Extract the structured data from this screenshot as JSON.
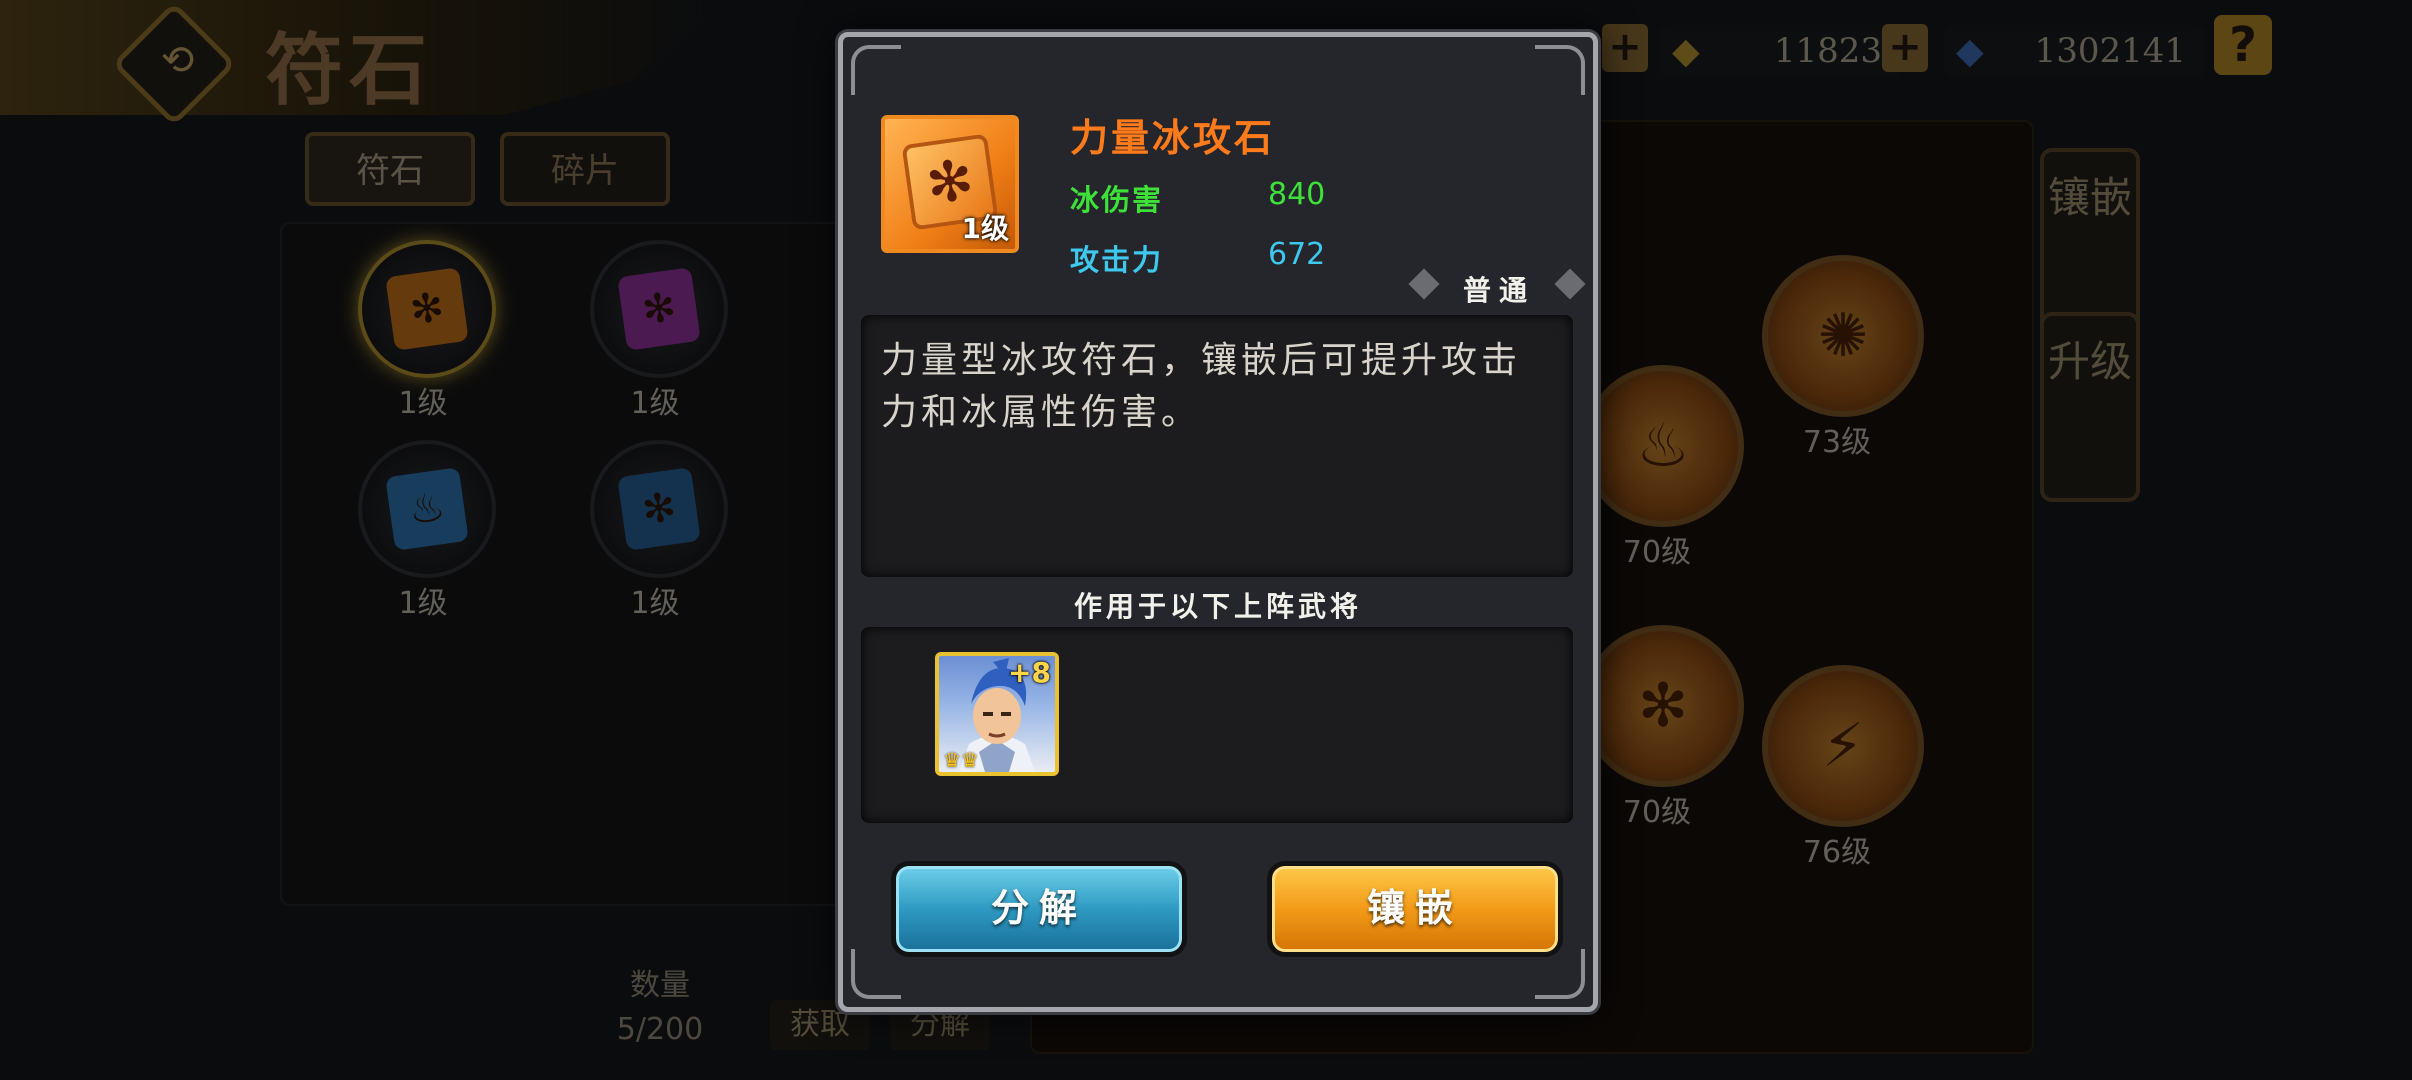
{
  "screen": {
    "title": "符石",
    "currency": [
      {
        "name": "gold-ingot",
        "value": "11823",
        "icon": "gold-ingot-icon"
      },
      {
        "name": "gem",
        "value": "1302141",
        "icon": "blue-gem-icon"
      }
    ],
    "help_label": "?",
    "plus_label": "+",
    "back_label": "⟲"
  },
  "tabs": [
    {
      "label": "符石"
    },
    {
      "label": "碎片"
    }
  ],
  "stone_list": [
    {
      "level": "1级",
      "color": "#f08a20",
      "icon": "snowflake-icon",
      "selected": true
    },
    {
      "level": "1级",
      "color": "#b03fbe",
      "icon": "snowflake-icon",
      "selected": false
    },
    {
      "level": "1级",
      "color": "#3a8fd8",
      "icon": "flame-icon",
      "selected": false
    },
    {
      "level": "1级",
      "color": "#2f77b8",
      "icon": "snowflake-icon",
      "selected": false
    }
  ],
  "inventory": {
    "count_label": "数量",
    "count_value": "5/200",
    "obtain_label": "获取",
    "decompose_label": "分解"
  },
  "ring": [
    {
      "level": "73级",
      "icon": "tornado-icon"
    },
    {
      "level": "70级",
      "icon": "flame-icon"
    },
    {
      "level": "70级",
      "icon": "snowflake-icon"
    },
    {
      "level": "76级",
      "icon": "claw-icon"
    }
  ],
  "side_tabs": [
    {
      "label": "镶嵌"
    },
    {
      "label": "升级"
    }
  ],
  "modal": {
    "item_name": "力量冰攻石",
    "item_level": "1级",
    "item_icon": "snowflake-icon",
    "stats": [
      {
        "label": "冰伤害",
        "value": "840",
        "color": "#3ee03a"
      },
      {
        "label": "攻击力",
        "value": "672",
        "color": "#3ec8ee"
      }
    ],
    "rarity": "普通",
    "description": "力量型冰攻符石，镶嵌后可提升攻击力和冰属性伤害。",
    "heroes_title": "作用于以下上阵武将",
    "heroes": [
      {
        "plus": "+8",
        "crowns": "♛♛"
      }
    ],
    "buttons": {
      "decompose": "分解",
      "inlay": "镶嵌"
    }
  },
  "colors": {
    "item_name": "#ff7a1a",
    "accent_gold": "#d6b23a",
    "button_blue": "#2e9ac2",
    "button_orange": "#f29a18"
  }
}
